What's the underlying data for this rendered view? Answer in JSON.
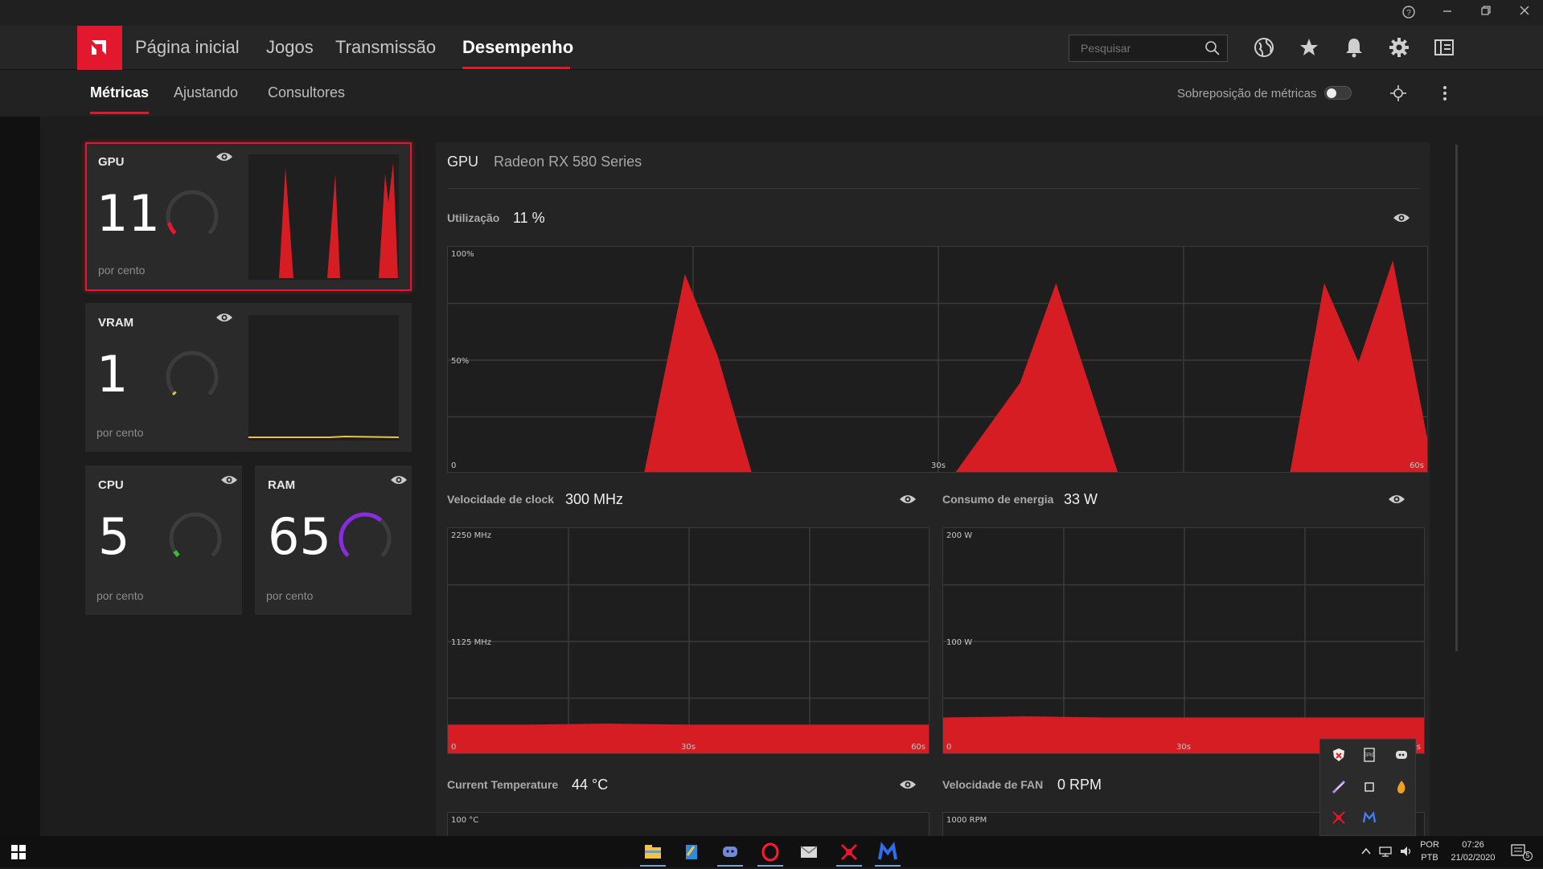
{
  "window": {
    "help_icon": "help-circle-icon",
    "controls": [
      "minimize",
      "restore",
      "close"
    ]
  },
  "nav": {
    "items": [
      {
        "label": "Página inicial"
      },
      {
        "label": "Jogos"
      },
      {
        "label": "Transmissão"
      },
      {
        "label": "Desempenho"
      }
    ],
    "active": "Desempenho",
    "search_placeholder": "Pesquisar",
    "icons": [
      "globe-icon",
      "star-icon",
      "bell-icon",
      "gear-icon",
      "panel-icon"
    ]
  },
  "subnav": {
    "items": [
      {
        "label": "Métricas"
      },
      {
        "label": "Ajustando"
      },
      {
        "label": "Consultores"
      }
    ],
    "active": "Métricas",
    "overlay_label": "Sobreposição de métricas",
    "overlay_enabled": false
  },
  "cards": {
    "gpu": {
      "title": "GPU",
      "value": "11",
      "unit": "por cento",
      "color": "#e3172d",
      "level": 0.11
    },
    "vram": {
      "title": "VRAM",
      "value": "1",
      "unit": "por cento",
      "color": "#e8c24a",
      "level": 0.01
    },
    "cpu": {
      "title": "CPU",
      "value": "5",
      "unit": "por cento",
      "color": "#31c13a",
      "level": 0.05
    },
    "ram": {
      "title": "RAM",
      "value": "65",
      "unit": "por cento",
      "color": "#8a2be2",
      "level": 0.65
    }
  },
  "panel": {
    "title": "GPU",
    "device": "Radeon RX 580 Series",
    "utilization": {
      "label": "Utilização",
      "value": "11 %",
      "ymax": "100%",
      "ymid": "50%",
      "x0": "0",
      "xmid": "30s",
      "xmax": "60s"
    },
    "clock": {
      "label": "Velocidade de clock",
      "value": "300 MHz",
      "ymax": "2250 MHz",
      "ymid": "1125 MHz",
      "x0": "0",
      "xmid": "30s",
      "xmax": "60s"
    },
    "power": {
      "label": "Consumo de energia",
      "value": "33 W",
      "ymax": "200 W",
      "ymid": "100 W",
      "x0": "0",
      "xmid": "30s",
      "xmax": "s"
    },
    "temp": {
      "label": "Current Temperature",
      "value": "44 °C",
      "ymax": "100 °C"
    },
    "fan": {
      "label": "Velocidade de FAN",
      "value": "0 RPM",
      "ymax": "1000 RPM"
    }
  },
  "chart_data": [
    {
      "type": "area",
      "ylabel": "",
      "ylim": [
        0,
        100
      ],
      "xlim": [
        0,
        60
      ],
      "x": [
        0,
        12,
        14.5,
        16.5,
        18.6,
        31,
        35,
        37.2,
        41,
        51.5,
        53.6,
        55.7,
        57.8,
        60
      ],
      "series": [
        {
          "values": [
            0,
            0,
            88,
            52,
            0,
            0,
            40,
            84,
            0,
            0,
            84,
            49,
            94,
            12
          ]
        }
      ]
    },
    {
      "type": "area",
      "ylim": [
        0,
        2250
      ],
      "xlim": [
        0,
        60
      ],
      "x": [
        0,
        10,
        20,
        30,
        40,
        50,
        60
      ],
      "series": [
        {
          "values": [
            300,
            300,
            310,
            300,
            300,
            300,
            300
          ]
        }
      ]
    },
    {
      "type": "area",
      "ylim": [
        0,
        200
      ],
      "xlim": [
        0,
        60
      ],
      "x": [
        0,
        10,
        20,
        30,
        40,
        50,
        60
      ],
      "series": [
        {
          "values": [
            33,
            34,
            33,
            33,
            33,
            33,
            33
          ]
        }
      ]
    }
  ],
  "taskbar": {
    "apps": [
      "file-explorer-icon",
      "notes-icon",
      "discord-icon",
      "opera-icon",
      "mail-icon",
      "amd-radeon-icon",
      "malwarebytes-icon"
    ],
    "lang1": "POR",
    "lang2": "PTB",
    "time": "07:26",
    "date": "21/02/2020",
    "notifications": "5"
  }
}
